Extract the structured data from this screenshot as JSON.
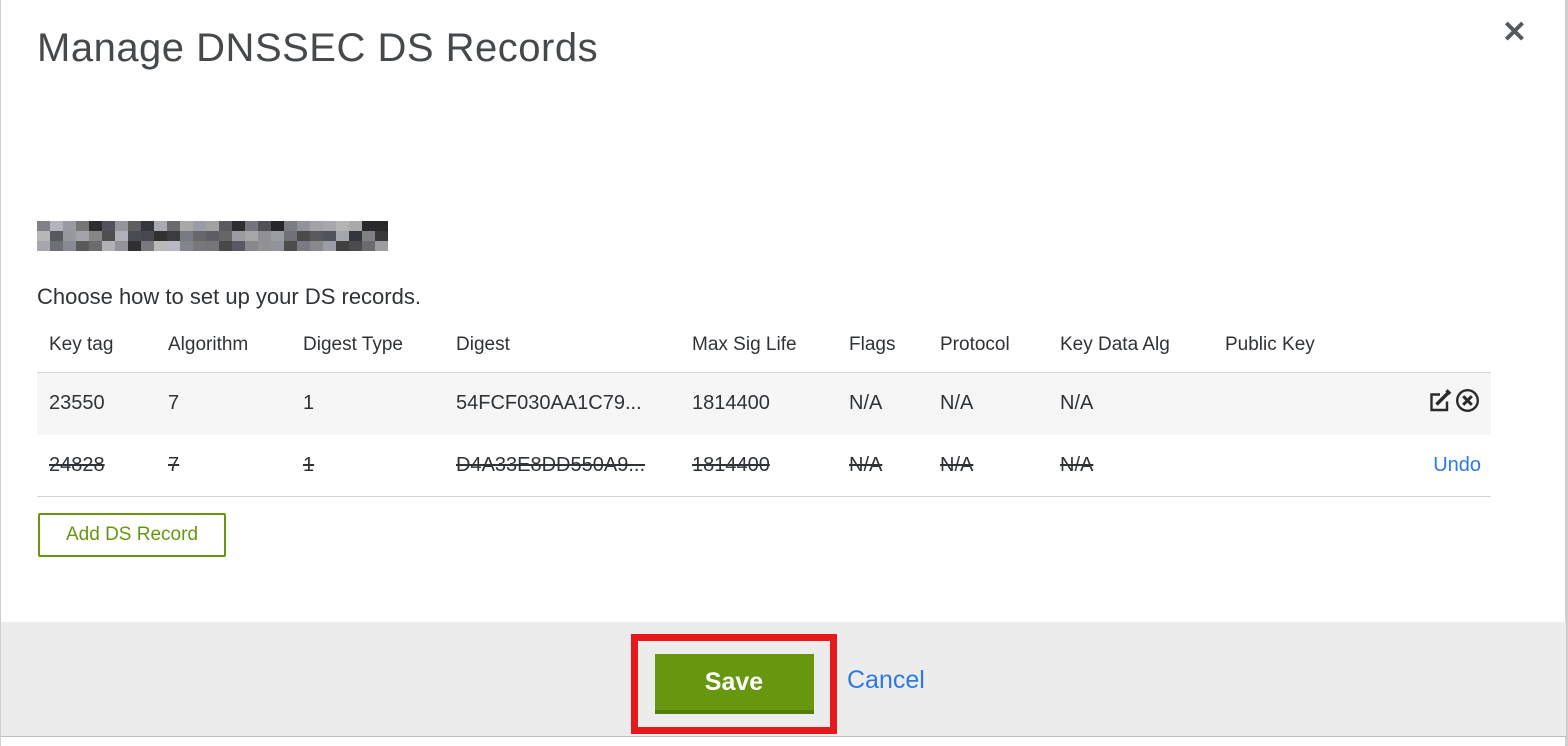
{
  "modal": {
    "title": "Manage DNSSEC DS Records",
    "close_glyph": "✕",
    "instruction": "Choose how to set up your DS records.",
    "table": {
      "headers": [
        "Key tag",
        "Algorithm",
        "Digest Type",
        "Digest",
        "Max Sig Life",
        "Flags",
        "Protocol",
        "Key Data Alg",
        "Public Key"
      ],
      "rows": [
        {
          "key_tag": "23550",
          "algorithm": "7",
          "digest_type": "1",
          "digest": "54FCF030AA1C79...",
          "max_sig_life": "1814400",
          "flags": "N/A",
          "protocol": "N/A",
          "key_data_alg": "N/A",
          "public_key": "",
          "deleted": false
        },
        {
          "key_tag": "24828",
          "algorithm": "7",
          "digest_type": "1",
          "digest": "D4A33E8DD550A9...",
          "max_sig_life": "1814400",
          "flags": "N/A",
          "protocol": "N/A",
          "key_data_alg": "N/A",
          "public_key": "",
          "deleted": true,
          "action_label": "Undo"
        }
      ]
    },
    "add_button_label": "Add DS Record",
    "footer": {
      "save_label": "Save",
      "cancel_label": "Cancel"
    }
  },
  "icons": {
    "close": "close-x-icon",
    "edit": "edit-pencil-square-icon",
    "delete": "circle-x-icon"
  },
  "colors": {
    "primary_green": "#67970E",
    "dark_green": "#547C0A",
    "link_blue": "#2D7AE2",
    "annotation_red": "#E7191B"
  }
}
